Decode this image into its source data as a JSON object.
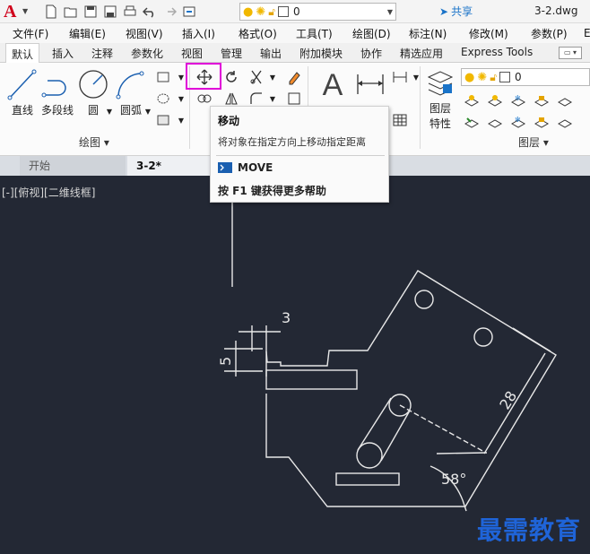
{
  "titlebar": {
    "app_logo": "A",
    "layer_value": "0",
    "share_label": "共享",
    "filename": "3-2.dwg"
  },
  "menu": {
    "items": [
      "文件(F)",
      "编辑(E)",
      "视图(V)",
      "插入(I)",
      "格式(O)",
      "工具(T)",
      "绘图(D)",
      "标注(N)",
      "修改(M)",
      "参数(P)",
      "E"
    ]
  },
  "ribbon_tabs": {
    "items": [
      "默认",
      "插入",
      "注释",
      "参数化",
      "视图",
      "管理",
      "输出",
      "附加模块",
      "协作",
      "精选应用",
      "Express Tools"
    ],
    "active": "默认"
  },
  "ribbon": {
    "draw_tools": {
      "line": "直线",
      "polyline": "多段线",
      "circle": "圆",
      "arc": "圆弧"
    },
    "draw_panel_label": "绘图",
    "layer_props_label_1": "图层",
    "layer_props_label_2": "特性",
    "layer_value": "0",
    "layers_panel_label": "图层",
    "text_glyph": "A"
  },
  "doc_tabs": {
    "start": "开始",
    "current": "3-2*"
  },
  "viewport": {
    "label": "[-][俯视][二维线框]"
  },
  "tooltip": {
    "title": "移动",
    "description": "将对象在指定方向上移动指定距离",
    "command": "MOVE",
    "help": "按 F1 键获得更多帮助"
  },
  "drawing": {
    "dim_3": "3",
    "dim_5": "5",
    "dim_28": "28",
    "dim_58": "58°"
  },
  "watermark": "最需教育",
  "colors": {
    "canvas": "#232834",
    "highlight": "#e000d8",
    "share": "#1a73c8",
    "watermark": "#1f64d8"
  }
}
